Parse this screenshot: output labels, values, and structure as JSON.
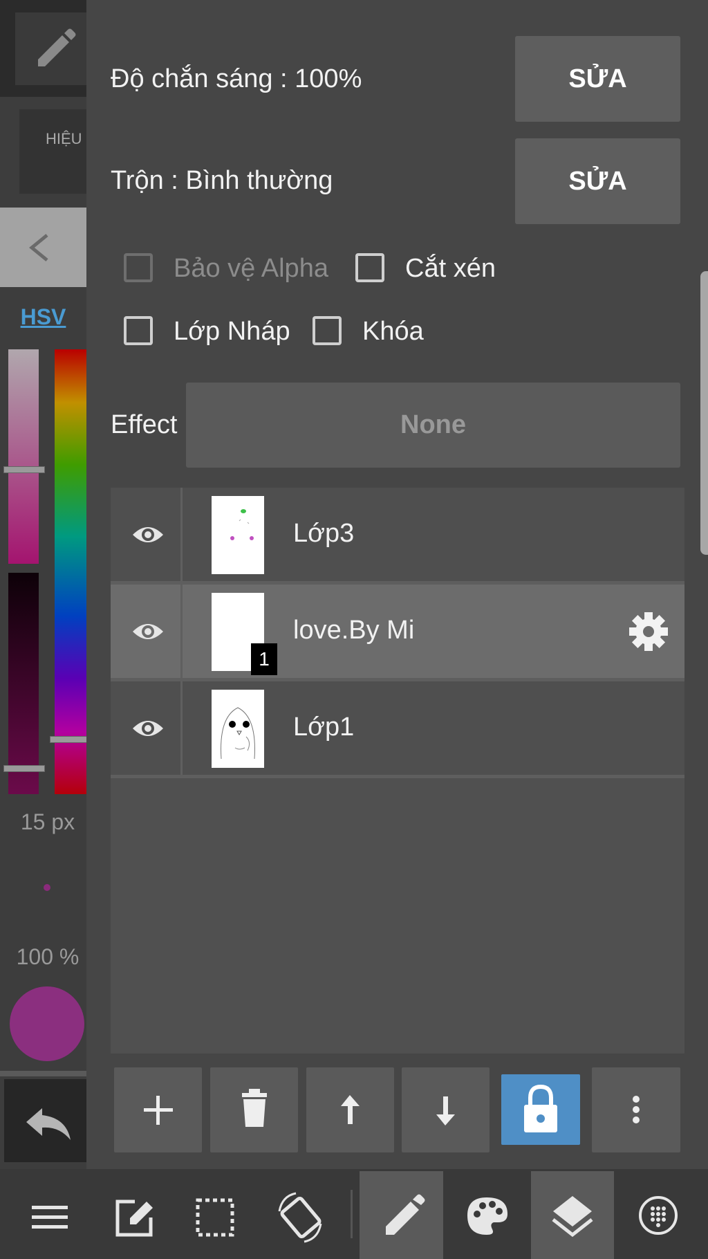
{
  "left_panel": {
    "effect_tab": "HIỆU",
    "color_mode": "HSV",
    "brush_size": "15 px",
    "brush_opacity": "100 %",
    "current_color": "#8b2f7f"
  },
  "layer_props": {
    "opacity_label": "Độ chắn sáng : 100%",
    "opacity_edit": "SỬA",
    "blend_label": "Trộn : Bình thường",
    "blend_edit": "SỬA",
    "protect_alpha": "Bảo vệ Alpha",
    "clipping": "Cắt xén",
    "draft_layer": "Lớp Nháp",
    "lock": "Khóa",
    "effect_label": "Effect",
    "effect_value": "None"
  },
  "layers": [
    {
      "name": "Lớp3",
      "visible": true
    },
    {
      "name": "love.By Mi",
      "visible": true,
      "selected": true,
      "badge": "1"
    },
    {
      "name": "Lớp1",
      "visible": true
    }
  ],
  "layer_toolbar": [
    "add-icon",
    "trash-icon",
    "arrow-up-icon",
    "arrow-down-icon",
    "lock-icon",
    "more-vert-icon"
  ],
  "bottom_bar": [
    "menu-icon",
    "edit-canvas-icon",
    "selection-icon",
    "rotate-icon",
    "pen-icon",
    "palette-icon",
    "layers-icon",
    "materials-icon"
  ],
  "colors": {
    "accent": "#4f8fc6",
    "link": "#4a9bd2"
  }
}
